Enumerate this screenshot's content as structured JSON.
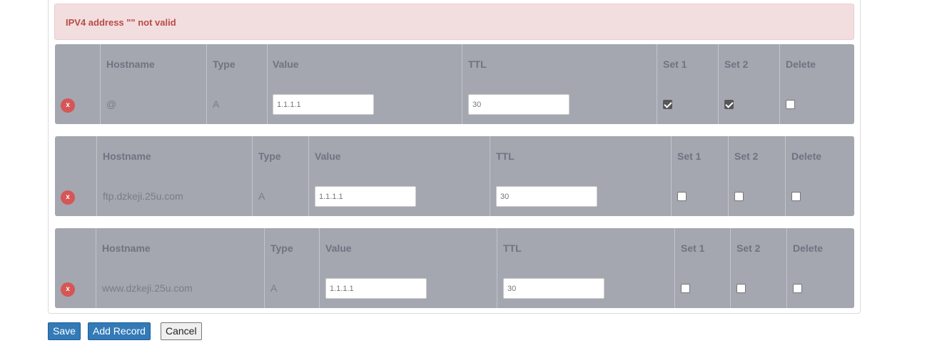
{
  "alert": {
    "message": "IPV4 address \"\" not valid"
  },
  "headers": {
    "hostname": "Hostname",
    "type": "Type",
    "value": "Value",
    "ttl": "TTL",
    "set1": "Set 1",
    "set2": "Set 2",
    "delete": "Delete"
  },
  "delete_symbol": "x",
  "records": [
    {
      "hostname": "@",
      "type": "A",
      "value": "1.1.1.1",
      "ttl": "30",
      "set1": true,
      "set2": true,
      "delete": false
    },
    {
      "hostname": "ftp.dzkeji.25u.com",
      "type": "A",
      "value": "1.1.1.1",
      "ttl": "30",
      "set1": false,
      "set2": false,
      "delete": false
    },
    {
      "hostname": "www.dzkeji.25u.com",
      "type": "A",
      "value": "1.1.1.1",
      "ttl": "30",
      "set1": false,
      "set2": false,
      "delete": false
    }
  ],
  "buttons": {
    "save": "Save",
    "add_record": "Add Record",
    "cancel": "Cancel"
  },
  "colors": {
    "row_bg": "#a4a6b0",
    "alert_bg": "#f2dede",
    "alert_text": "#b94a48",
    "delete_icon": "#d65656",
    "primary": "#337ab7"
  }
}
